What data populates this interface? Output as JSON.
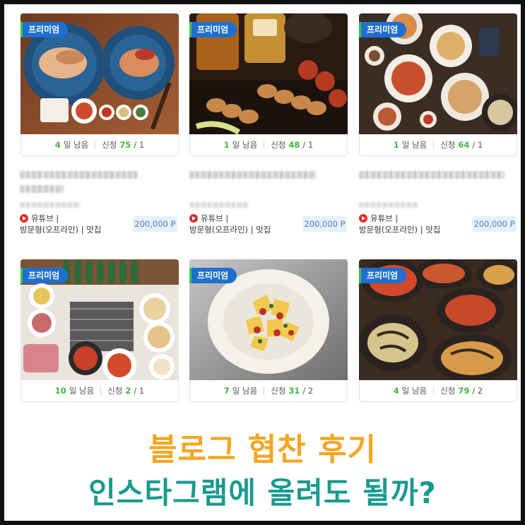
{
  "cards": [
    {
      "badge": "프리미엄",
      "days": "4",
      "days_label": "일 남음",
      "apply_label": "신청",
      "applied": "75",
      "slots": "/ 1"
    },
    {
      "badge": "프리미엄",
      "days": "1",
      "days_label": "일 남음",
      "apply_label": "신청",
      "applied": "48",
      "slots": "/ 1"
    },
    {
      "badge": "프리미엄",
      "days": "1",
      "days_label": "일 남음",
      "apply_label": "신청",
      "applied": "64",
      "slots": "/ 1"
    },
    {
      "badge": "프리미엄",
      "days": "10",
      "days_label": "일 남음",
      "apply_label": "신청",
      "applied": "2",
      "slots": "/ 1"
    },
    {
      "badge": "프리미엄",
      "days": "7",
      "days_label": "일 남음",
      "apply_label": "신청",
      "applied": "31",
      "slots": "/ 2"
    },
    {
      "badge": "프리미엄",
      "days": "4",
      "days_label": "일 남음",
      "apply_label": "신청",
      "applied": "79",
      "slots": "/ 2"
    }
  ],
  "listings": [
    {
      "platform": "유튜브 |",
      "type": "방문형(오프라인) | 맛집",
      "price": "200,000 P"
    },
    {
      "platform": "유튜브 |",
      "type": "방문형(오프라인) | 맛집",
      "price": "200,000 P"
    },
    {
      "platform": "유튜브 |",
      "type": "방문형(오프라인) | 맛집",
      "price": "200,000 P"
    }
  ],
  "headline": {
    "line1": "블로그 협찬 후기",
    "line2": "인스타그램에 올려도 될까?"
  },
  "colors": {
    "badge": "#1e6fd0",
    "badge_accent": "#3ec44c",
    "days_green": "#3db83d",
    "price_bg": "#e6f0fb",
    "headline1": "#f5a623",
    "headline2": "#1a9a8f"
  },
  "icons": [
    "youtube-icon"
  ]
}
